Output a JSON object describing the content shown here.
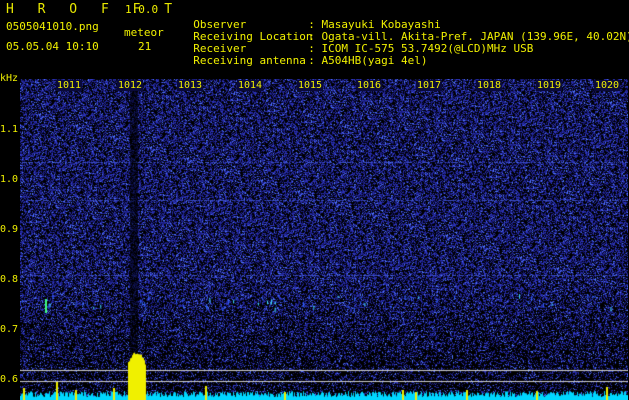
{
  "app": {
    "name": "H R O F F T",
    "version": "1.0.0"
  },
  "file": {
    "name": "0505041010.png",
    "timestamp": "05.05.04 10:10"
  },
  "counter": {
    "label": "meteor",
    "value": "21"
  },
  "meta": [
    {
      "key": "Observer",
      "value": ": Masayuki Kobayashi"
    },
    {
      "key": "Receiving Location",
      "value": ": Ogata-vill. Akita-Pref. JAPAN (139.96E, 40.02N)"
    },
    {
      "key": "Receiver",
      "value": ": ICOM IC-575 53.7492(@LCD)MHz USB"
    },
    {
      "key": "Receiving antenna",
      "value": ": A504HB(yagi 4el)"
    }
  ],
  "axis": {
    "y_unit": "kHz",
    "y_ticks": [
      "1.1",
      "1.0",
      "0.9",
      "0.8",
      "0.7",
      "0.6"
    ],
    "x_ticks": [
      "1011",
      "1012",
      "1013",
      "1014",
      "1015",
      "1016",
      "1017",
      "1018",
      "1019",
      "1020"
    ]
  },
  "colors": {
    "text": "#f0f000",
    "background": "#000000",
    "noise": "#1a1a8a",
    "trace": "#00e0ff"
  }
}
